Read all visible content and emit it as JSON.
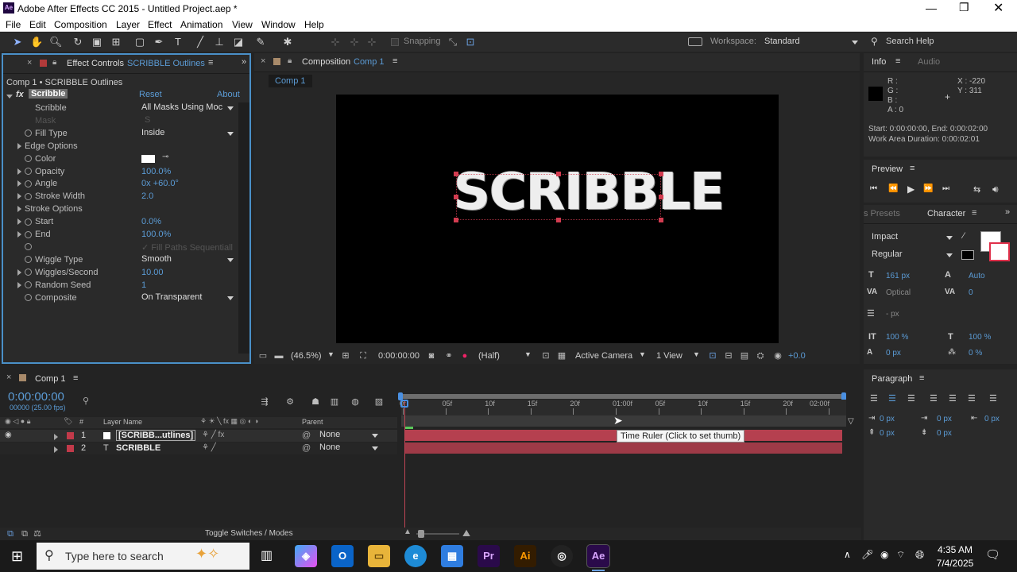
{
  "window": {
    "title": "Adobe After Effects CC 2015 - Untitled Project.aep *",
    "app_icon": "Ae"
  },
  "menu": [
    "File",
    "Edit",
    "Composition",
    "Layer",
    "Effect",
    "Animation",
    "View",
    "Window",
    "Help"
  ],
  "toolbar": {
    "snapping_label": "Snapping",
    "workspace_label": "Workspace:",
    "workspace_value": "Standard",
    "search_placeholder": "Search Help"
  },
  "effect_controls": {
    "tab_title": "Effect Controls",
    "tab_layer": "SCRIBBLE Outlines",
    "breadcrumb": "Comp 1 • SCRIBBLE Outlines",
    "effect_name": "Scribble",
    "reset_label": "Reset",
    "about_label": "About",
    "rows": [
      {
        "label": "Scribble",
        "value": "All Masks Using Moc",
        "kind": "dropdown"
      },
      {
        "label": "Mask",
        "value": "S",
        "kind": "disabled"
      },
      {
        "label": "Fill Type",
        "value": "Inside",
        "kind": "dropdown"
      },
      {
        "label": "Edge Options",
        "value": "",
        "kind": "group"
      },
      {
        "label": "Color",
        "value": "",
        "kind": "color"
      },
      {
        "label": "Opacity",
        "value": "100.0%",
        "kind": "num"
      },
      {
        "label": "Angle",
        "value": "0x +60.0°",
        "kind": "num"
      },
      {
        "label": "Stroke Width",
        "value": "2.0",
        "kind": "num"
      },
      {
        "label": "Stroke Options",
        "value": "",
        "kind": "group"
      },
      {
        "label": "Start",
        "value": "0.0%",
        "kind": "num"
      },
      {
        "label": "End",
        "value": "100.0%",
        "kind": "num"
      },
      {
        "label": "",
        "value": "Fill Paths Sequentiall",
        "kind": "check"
      },
      {
        "label": "Wiggle Type",
        "value": "Smooth",
        "kind": "dropdown"
      },
      {
        "label": "Wiggles/Second",
        "value": "10.00",
        "kind": "num"
      },
      {
        "label": "Random Seed",
        "value": "1",
        "kind": "num"
      },
      {
        "label": "Composite",
        "value": "On Transparent",
        "kind": "dropdown"
      }
    ]
  },
  "composition": {
    "tab_title": "Composition",
    "tab_comp": "Comp 1",
    "sub_tab": "Comp 1",
    "canvas_text": "SCRIBBLE",
    "zoom": "(46.5%)",
    "timecode": "0:00:00:00",
    "resolution": "(Half)",
    "camera": "Active Camera",
    "view": "1 View",
    "exposure": "+0.0"
  },
  "info": {
    "tab_info": "Info",
    "tab_audio": "Audio",
    "r": "R :",
    "g": "G :",
    "b": "B :",
    "a": "A : 0",
    "x": "X : -220",
    "y": "Y : 311",
    "start_line": "Start: 0:00:00:00, End: 0:00:02:00",
    "duration_line": "Work Area Duration: 0:00:02:01"
  },
  "preview": {
    "title": "Preview"
  },
  "character": {
    "tab_presets": "s Presets",
    "tab_character": "Character",
    "font": "Impact",
    "style": "Regular",
    "size": "161 px",
    "leading": "Auto",
    "kerning": "Optical",
    "tracking": "0",
    "stroke": "- px",
    "vscale": "100 %",
    "hscale": "100 %",
    "baseline": "0 px",
    "tsume": "0 %"
  },
  "paragraph": {
    "title": "Paragraph",
    "indent_left": "0 px",
    "indent_first": "0 px",
    "indent_right": "0 px",
    "space_before": "0 px",
    "space_after": "0 px"
  },
  "timeline": {
    "tab": "Comp 1",
    "timecode": "0:00:00:00",
    "fps": "00000 (25.00 fps)",
    "col_hash": "#",
    "col_layer": "Layer Name",
    "col_parent": "Parent",
    "ruler": [
      "0f",
      "05f",
      "10f",
      "15f",
      "20f",
      "01:00f",
      "05f",
      "10f",
      "15f",
      "20f",
      "02:00f"
    ],
    "layers": [
      {
        "num": "1",
        "name": "[SCRIBB...utlines]",
        "parent": "None"
      },
      {
        "num": "2",
        "name": "SCRIBBLE",
        "parent": "None"
      }
    ],
    "tooltip": "Time Ruler (Click to set thumb)",
    "toggle_label": "Toggle Switches / Modes"
  },
  "taskbar": {
    "search_placeholder": "Type here to search",
    "time": "4:35 AM",
    "date": "7/4/2025"
  },
  "colors": {
    "accent": "#5b9bd5",
    "layer_bar": "#b5404f",
    "panel": "#2a2a2a",
    "focus": "#4a90c8"
  }
}
